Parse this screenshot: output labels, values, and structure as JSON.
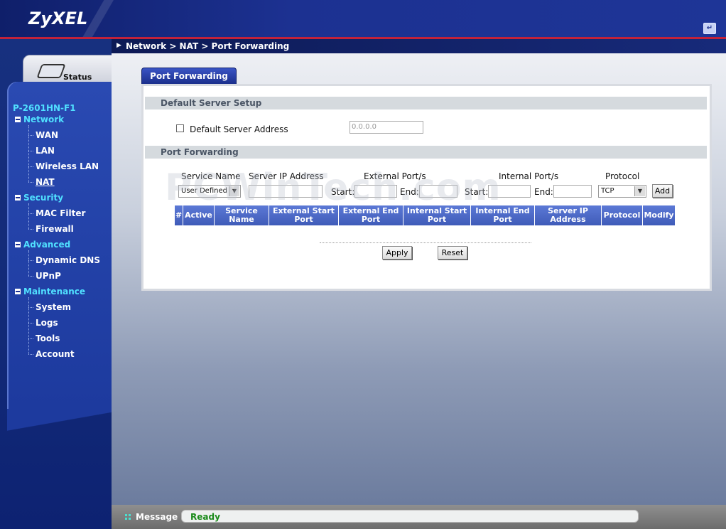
{
  "header": {
    "brand": "ZyXEL",
    "logout_icon": "logout-icon"
  },
  "breadcrumb": "Network > NAT > Port Forwarding",
  "sidebar": {
    "status_tab": "Status",
    "model": "P-2601HN-F1",
    "groups": [
      {
        "label": "Network",
        "items": [
          "WAN",
          "LAN",
          "Wireless LAN",
          "NAT"
        ]
      },
      {
        "label": "Security",
        "items": [
          "MAC Filter",
          "Firewall"
        ]
      },
      {
        "label": "Advanced",
        "items": [
          "Dynamic DNS",
          "UPnP"
        ]
      },
      {
        "label": "Maintenance",
        "items": [
          "System",
          "Logs",
          "Tools",
          "Account"
        ]
      }
    ],
    "active_item": "NAT"
  },
  "tab": "Port Forwarding",
  "default_server": {
    "section_title": "Default Server Setup",
    "checkbox_label": "Default Server Address",
    "address_placeholder": "0.0.0.0"
  },
  "port_forwarding": {
    "section_title": "Port Forwarding",
    "labels": {
      "service_name": "Service Name",
      "server_ip": "Server IP Address",
      "external_ports": "External Port/s",
      "internal_ports": "Internal Port/s",
      "protocol": "Protocol",
      "start": "Start:",
      "end": "End:"
    },
    "service_select": "User Defined",
    "protocol_select": "TCP",
    "add_button": "Add",
    "columns": [
      "#",
      "Active",
      "Service Name",
      "External Start Port",
      "External End Port",
      "Internal Start Port",
      "Internal End Port",
      "Server IP Address",
      "Protocol",
      "Modify"
    ]
  },
  "actions": {
    "apply": "Apply",
    "reset": "Reset"
  },
  "message": {
    "label": "Message",
    "status": "Ready"
  },
  "watermark": "PCWinTech.com"
}
